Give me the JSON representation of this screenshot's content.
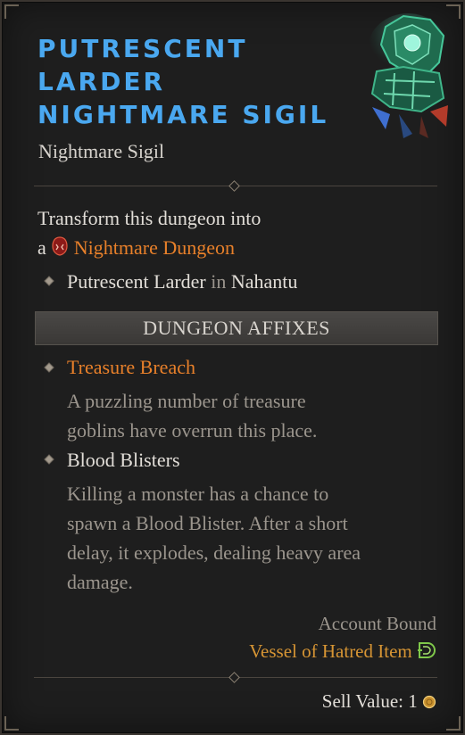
{
  "item": {
    "title_lines": [
      "PUTRESCENT",
      "LARDER",
      "NIGHTMARE SIGIL"
    ],
    "subtitle": "Nightmare Sigil",
    "art_icon": "nightmare-sigil-icon"
  },
  "transform": {
    "line1": "Transform this dungeon into",
    "prefix": "a",
    "dungeon_label": "Nightmare Dungeon",
    "dungeon_icon": "nightmare-dungeon-icon",
    "location_name": "Putrescent Larder",
    "location_connector": "in",
    "location_region": "Nahantu"
  },
  "affixes": {
    "header": "DUNGEON AFFIXES",
    "items": [
      {
        "name": "Treasure Breach",
        "desc_lines": [
          "A puzzling number of treasure",
          "goblins have overrun this place."
        ]
      },
      {
        "name": "Blood Blisters",
        "desc_lines": [
          "Killing a monster has a chance to",
          "spawn a Blood Blister. After a short",
          "delay, it explodes, dealing heavy area",
          "damage."
        ]
      }
    ]
  },
  "footer": {
    "bound": "Account Bound",
    "expansion": "Vessel of Hatred Item",
    "expansion_icon": "vessel-of-hatred-icon",
    "sell_label": "Sell Value: 1",
    "gold_icon": "gold-coin-icon"
  },
  "colors": {
    "title": "#4aa8f0",
    "nightmare": "#e8802a",
    "expansion": "#d79534"
  }
}
